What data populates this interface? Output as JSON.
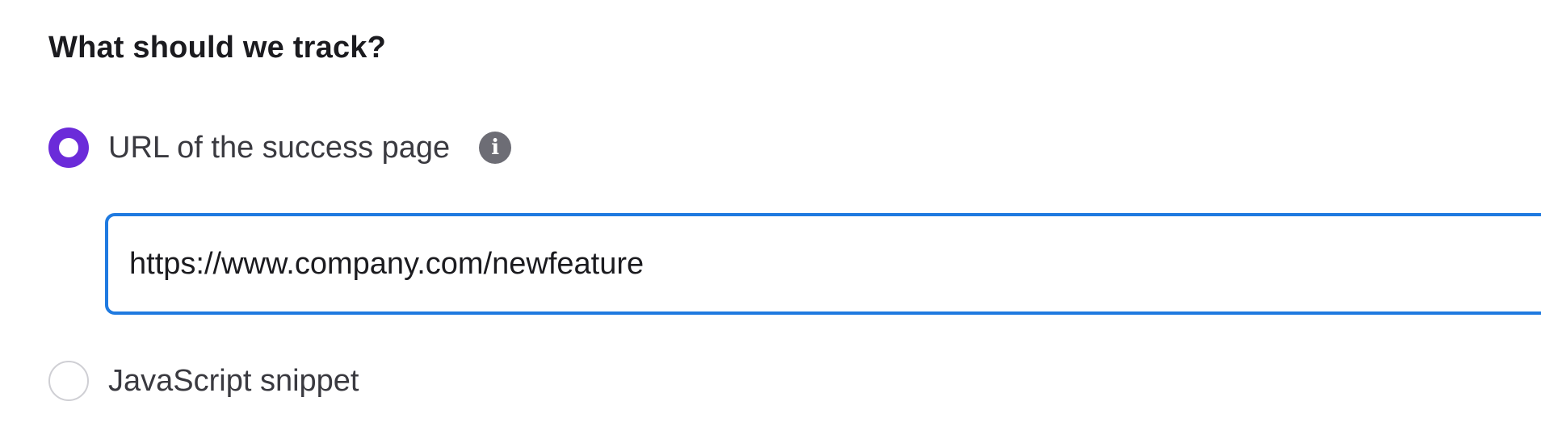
{
  "section": {
    "title": "What should we track?"
  },
  "options": {
    "url": {
      "label": "URL of the success page",
      "selected": true,
      "info_icon": "info-icon",
      "input_value": "https://www.company.com/newfeature"
    },
    "javascript": {
      "label": "JavaScript snippet",
      "selected": false
    }
  },
  "colors": {
    "radio_selected": "#6b2bd9",
    "input_focus_border": "#1f7ae0",
    "info_icon_bg": "#6d6d75"
  }
}
